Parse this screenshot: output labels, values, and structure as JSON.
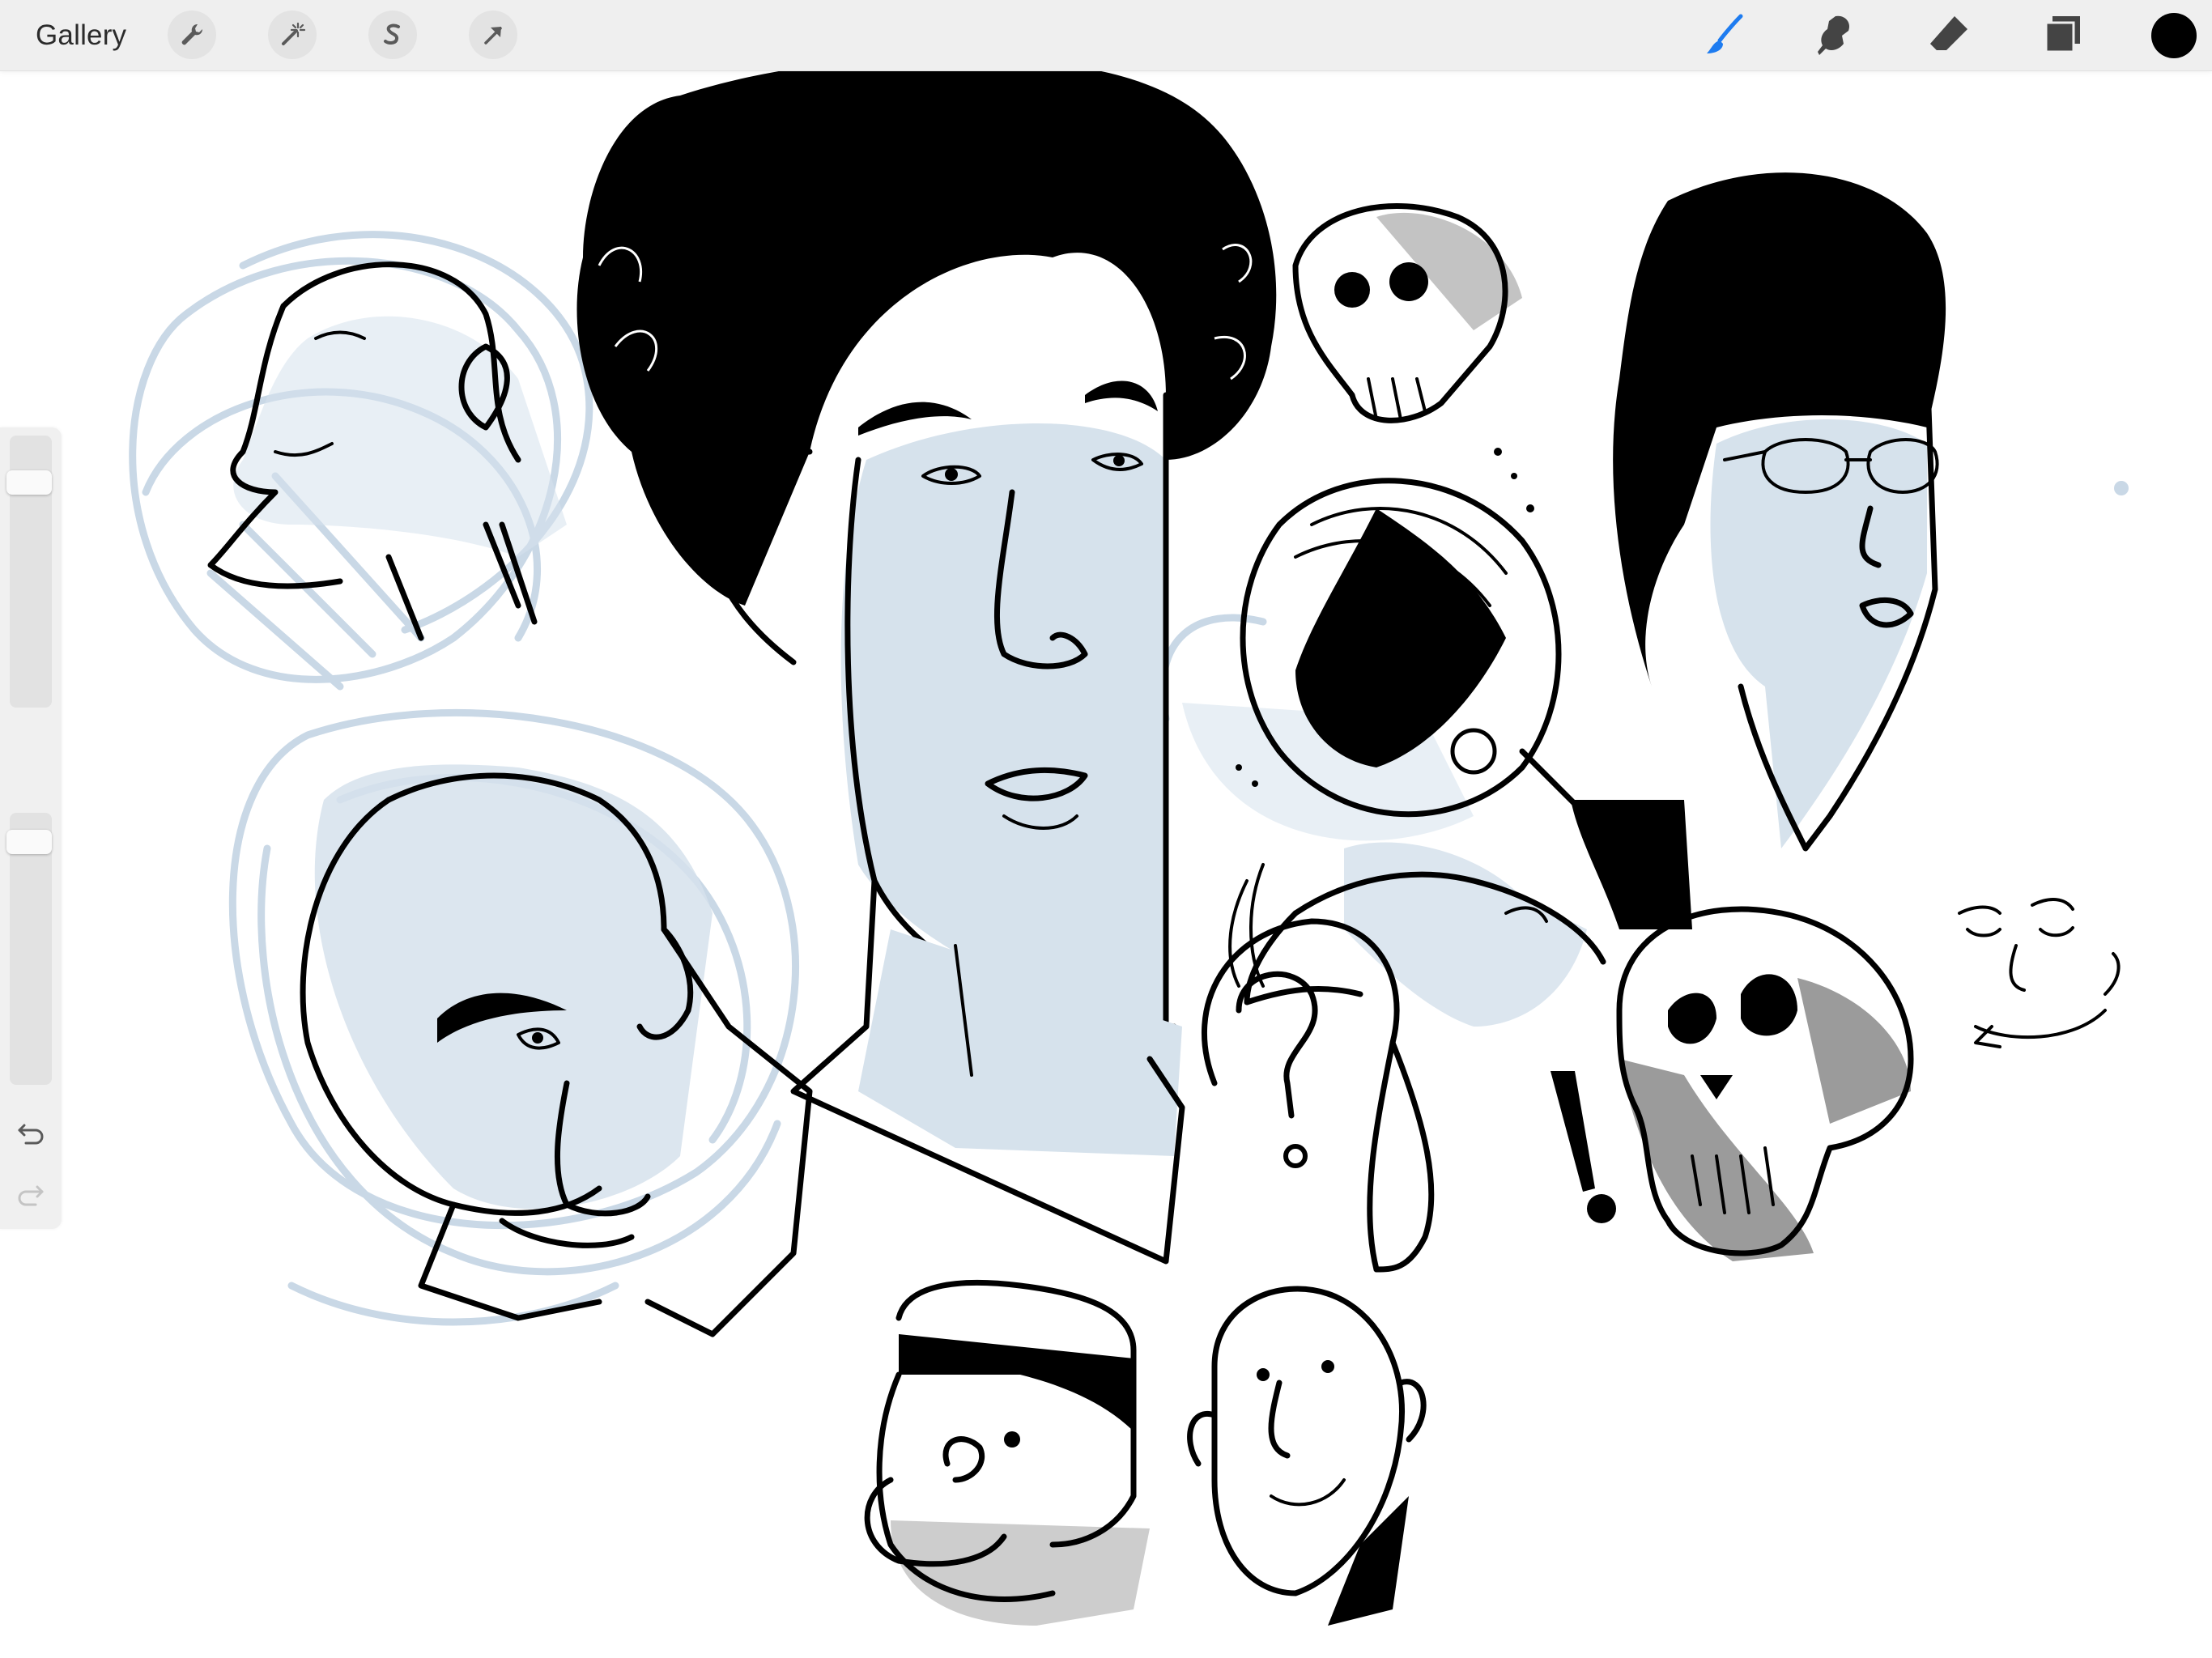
{
  "toolbar": {
    "gallery_label": "Gallery",
    "left_tools": [
      {
        "name": "actions",
        "icon": "wrench-icon"
      },
      {
        "name": "adjustments",
        "icon": "magic-wand-icon"
      },
      {
        "name": "selection",
        "icon": "selection-s-icon"
      },
      {
        "name": "transform",
        "icon": "cursor-arrow-icon"
      }
    ],
    "right_tools": [
      {
        "name": "brush",
        "icon": "brush-icon",
        "active": true
      },
      {
        "name": "smudge",
        "icon": "smudge-icon",
        "active": false
      },
      {
        "name": "eraser",
        "icon": "eraser-icon",
        "active": false
      },
      {
        "name": "layers",
        "icon": "layers-icon",
        "active": false
      }
    ],
    "current_color": "#000000",
    "active_tool_color": "#1e7cf0"
  },
  "sidebar": {
    "brush_size_level": 0.14,
    "opacity_level": 0.07,
    "undo_icon": "undo-icon",
    "redo_icon": "redo-icon"
  },
  "canvas": {
    "ink_color": "#000000",
    "sketch_color": "#c9d8e6",
    "fill_color": "#d6e2ec",
    "grey_color": "#9b9b9b",
    "background": "#ffffff"
  }
}
